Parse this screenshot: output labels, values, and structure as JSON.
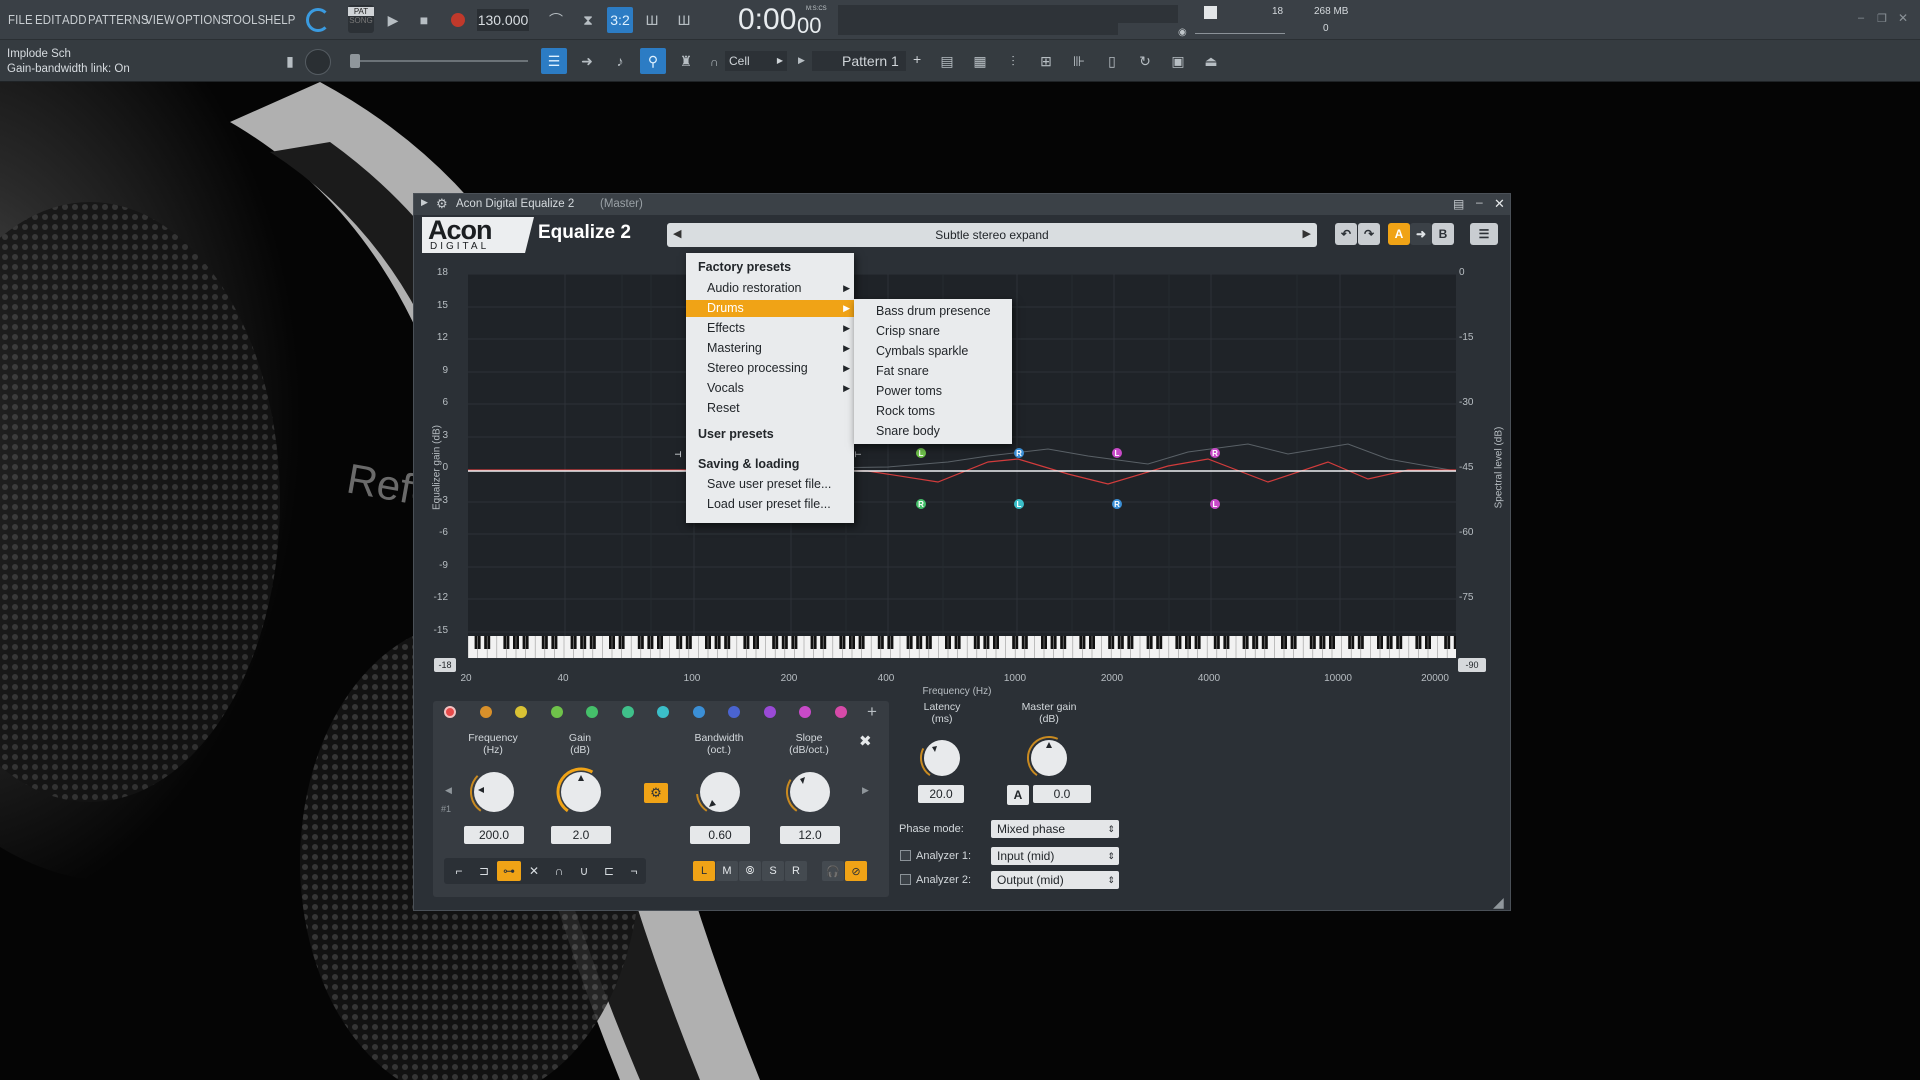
{
  "daw": {
    "menu": [
      "FILE",
      "EDIT",
      "ADD",
      "PATTERNS",
      "VIEW",
      "OPTIONS",
      "TOOLS",
      "HELP"
    ],
    "pat_label": "PAT",
    "song_label": "SONG",
    "tempo": "130.000",
    "time": "0:00",
    "time_small": "00",
    "time_unit": "M:S:CS",
    "cpu_value": "18",
    "memory": "268 MB",
    "poly": "0",
    "hint_title": "Implode Sch",
    "hint_text": "Gain-bandwidth link: On",
    "snap": "Cell",
    "pattern": "Pattern 1",
    "pattern_plus": "+"
  },
  "plugin": {
    "window_title": "Acon Digital Equalize 2",
    "window_title_suffix": "(Master)",
    "brand_top": "Acon",
    "brand_bottom": "DIGITAL",
    "name": "Equalize 2",
    "preset": "Subtle stereo expand",
    "ab": [
      "A",
      "B"
    ],
    "graph": {
      "y_left_label": "Equalizer gain (dB)",
      "y_right_label": "Spectral level (dB)",
      "x_label": "Frequency (Hz)",
      "y_left_ticks": [
        "18",
        "15",
        "12",
        "9",
        "6",
        "3",
        "0",
        "-3",
        "-6",
        "-9",
        "-12",
        "-15"
      ],
      "y_right_ticks": [
        "0",
        "-15",
        "-30",
        "-45",
        "-60",
        "-75"
      ],
      "x_ticks": [
        "20",
        "40",
        "100",
        "200",
        "400",
        "1000",
        "2000",
        "4000",
        "10000",
        "20000"
      ],
      "range_left": "-18",
      "range_right": "-90",
      "nodes_top": [
        "L",
        "R",
        "L",
        "R"
      ],
      "nodes_bottom": [
        "L",
        "R",
        "L",
        "R",
        "L"
      ]
    },
    "menu": {
      "factory_header": "Factory presets",
      "factory_items": [
        "Audio restoration",
        "Drums",
        "Effects",
        "Mastering",
        "Stereo processing",
        "Vocals",
        "Reset"
      ],
      "user_header": "User presets",
      "saving_header": "Saving & loading",
      "saving_items": [
        "Save user preset file...",
        "Load user preset file..."
      ],
      "submenu": [
        "Bass drum presence",
        "Crisp snare",
        "Cymbals sparkle",
        "Fat snare",
        "Power toms",
        "Rock toms",
        "Snare body"
      ]
    },
    "band": {
      "index": "#1",
      "frequency_label": "Frequency",
      "frequency_unit": "(Hz)",
      "frequency_value": "200.0",
      "gain_label": "Gain",
      "gain_unit": "(dB)",
      "gain_value": "2.0",
      "bandwidth_label": "Bandwidth",
      "bandwidth_unit": "(oct.)",
      "bandwidth_value": "0.60",
      "slope_label": "Slope",
      "slope_unit": "(dB/oct.)",
      "slope_value": "12.0",
      "channels": [
        "L",
        "M",
        "S",
        "R"
      ]
    },
    "master": {
      "latency_label": "Latency",
      "latency_unit": "(ms)",
      "latency_value": "20.0",
      "gain_label": "Master gain",
      "gain_unit": "(dB)",
      "gain_value": "0.0",
      "auto_label": "A",
      "phase_mode_label": "Phase mode:",
      "phase_mode": "Mixed phase",
      "analyzer1_label": "Analyzer 1:",
      "analyzer1": "Input (mid)",
      "analyzer2_label": "Analyzer 2:",
      "analyzer2": "Output (mid)"
    },
    "band_colors": [
      "#e64a4a",
      "#d8902a",
      "#d9c234",
      "#6fc24a",
      "#45c06a",
      "#3fc08a",
      "#3bbfc9",
      "#3b8fd6",
      "#4a64d0",
      "#9a4ad6",
      "#c84ac8",
      "#d64aa8"
    ]
  }
}
